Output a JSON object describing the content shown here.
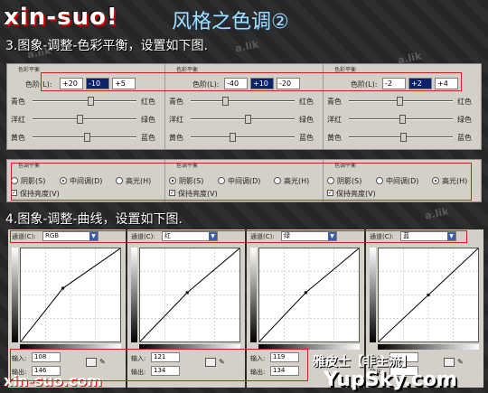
{
  "header": {
    "logo": "xin-suo!",
    "title": "风格之色调②",
    "step3": "3.图象-调整-色彩平衡，设置如下图.",
    "step4": "4.图象-调整-曲线，设置如下图."
  },
  "watermark": "a.lik",
  "color_balance": {
    "panel_title": "色彩平衡",
    "level_label": "色阶(L):",
    "slider_left": [
      "青色",
      "洋红",
      "黄色"
    ],
    "slider_right": [
      "红色",
      "绿色",
      "蓝色"
    ],
    "groups": [
      {
        "values": [
          "+20",
          "-10",
          "+5"
        ],
        "selected": 1,
        "sliders": [
          0.56,
          0.45,
          0.52
        ]
      },
      {
        "values": [
          "-40",
          "+10",
          "-20"
        ],
        "selected": 1,
        "sliders": [
          0.33,
          0.55,
          0.4
        ]
      },
      {
        "values": [
          "-2",
          "+2",
          "+4"
        ],
        "selected": 1,
        "sliders": [
          0.49,
          0.51,
          0.52
        ]
      }
    ]
  },
  "tone_balance": {
    "panel_title": "色调平衡",
    "options": [
      "阴影(S)",
      "中间调(D)",
      "高光(H)"
    ],
    "preserve": "保持亮度(V)",
    "groups": [
      {
        "selected": 1
      },
      {
        "selected": 0
      },
      {
        "selected": 2
      }
    ]
  },
  "curves": {
    "channel_label": "通道(C):",
    "input_label": "输入:",
    "output_label": "输出:",
    "panels": [
      {
        "channel": "RGB",
        "input": "108",
        "output": "146"
      },
      {
        "channel": "红",
        "input": "121",
        "output": "134"
      },
      {
        "channel": "绿",
        "input": "119",
        "output": "134"
      },
      {
        "channel": "蓝",
        "input": "",
        "output": ""
      }
    ]
  },
  "footer": {
    "signature": "雅皮士【非主流】",
    "site": "YupSky.com",
    "logo": "xin-suo.com"
  }
}
